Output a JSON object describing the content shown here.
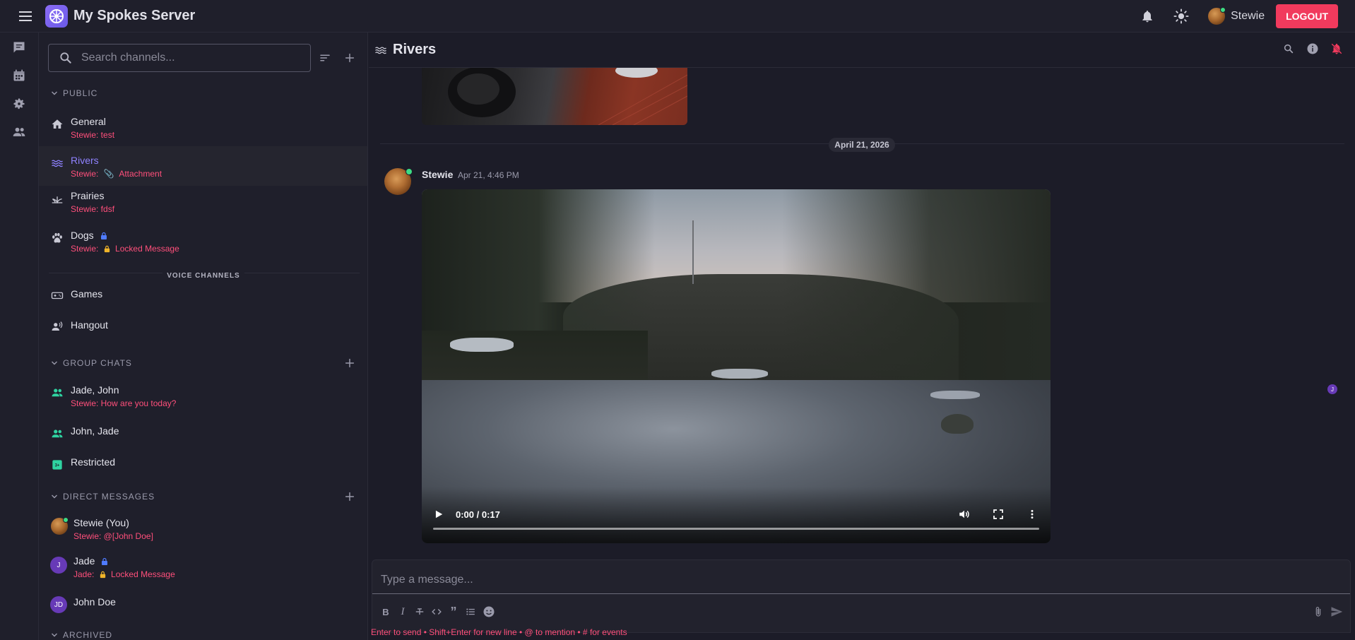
{
  "app": {
    "title": "My Spokes Server"
  },
  "user": {
    "name": "Stewie",
    "logout_label": "LOGOUT"
  },
  "sidebar": {
    "search_placeholder": "Search channels...",
    "public": {
      "label": "PUBLIC",
      "channels": [
        {
          "name": "General",
          "preview": "Stewie: test"
        },
        {
          "name": "Rivers",
          "preview_author": "Stewie:",
          "preview_text": "Attachment"
        },
        {
          "name": "Prairies",
          "preview": "Stewie: fdsf"
        },
        {
          "name": "Dogs",
          "preview_author": "Stewie:",
          "preview_text": "Locked Message"
        }
      ]
    },
    "voice": {
      "label": "VOICE CHANNELS",
      "channels": [
        {
          "name": "Games"
        },
        {
          "name": "Hangout"
        }
      ]
    },
    "group_chats": {
      "label": "GROUP CHATS",
      "items": [
        {
          "name": "Jade, John",
          "preview": "Stewie: How are you today?"
        },
        {
          "name": "John, Jade"
        },
        {
          "name": "Restricted"
        }
      ]
    },
    "direct_messages": {
      "label": "DIRECT MESSAGES",
      "items": [
        {
          "name": "Stewie (You)",
          "preview": "Stewie: @[John Doe]"
        },
        {
          "name": "Jade",
          "initial": "J",
          "preview_author": "Jade:",
          "preview_text": "Locked Message"
        },
        {
          "name": "John Doe",
          "initials": "JD"
        }
      ]
    },
    "archived": {
      "label": "ARCHIVED"
    }
  },
  "channel": {
    "name": "Rivers"
  },
  "messages": {
    "date_separator": "April 21, 2026",
    "author": "Stewie",
    "timestamp": "Apr 21, 4:46 PM",
    "video": {
      "time": "0:00 / 0:17",
      "progress": 0.0
    },
    "reader_initial": "J"
  },
  "composer": {
    "placeholder": "Type a message...",
    "hint": "Enter to send • Shift+Enter for new line • @ to mention • # for events"
  },
  "colors": {
    "accent": "#8f82ff",
    "logout": "#f13a5d",
    "preview": "#ff4f7b",
    "online": "#3ddc84",
    "avatar_purple": "#673ab7"
  }
}
